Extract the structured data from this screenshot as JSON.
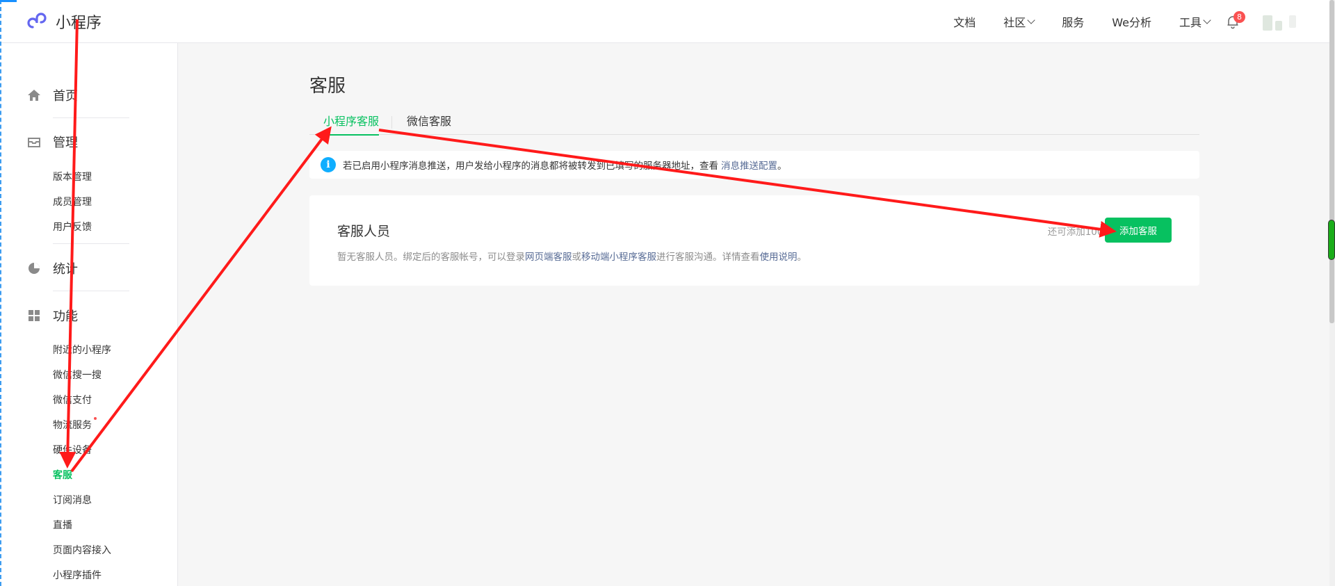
{
  "header": {
    "logo_text": "小程序",
    "nav": [
      {
        "label": "文档",
        "has_dropdown": false
      },
      {
        "label": "社区",
        "has_dropdown": true
      },
      {
        "label": "服务",
        "has_dropdown": false
      },
      {
        "label": "We分析",
        "has_dropdown": false
      },
      {
        "label": "工具",
        "has_dropdown": true
      }
    ],
    "notification_count": "8"
  },
  "sidebar": {
    "home": {
      "label": "首页",
      "icon": "home-icon"
    },
    "manage": {
      "label": "管理",
      "icon": "inbox-icon",
      "items": [
        "版本管理",
        "成员管理",
        "用户反馈"
      ]
    },
    "stats": {
      "label": "统计",
      "icon": "pie-chart-icon"
    },
    "features": {
      "label": "功能",
      "icon": "grid-icon",
      "items": [
        "附近的小程序",
        "微信搜一搜",
        "微信支付",
        "物流服务",
        "硬件设备",
        "客服",
        "订阅消息",
        "直播",
        "页面内容接入",
        "小程序插件"
      ]
    },
    "active_item": "客服"
  },
  "main": {
    "title": "客服",
    "tabs": [
      {
        "label": "小程序客服",
        "active": true
      },
      {
        "label": "微信客服",
        "active": false
      }
    ],
    "notice": {
      "text": "若已启用小程序消息推送，用户发给小程序的消息都将被转发到已填写的服务器地址，查看",
      "link": "消息推送配置",
      "end": "。"
    },
    "card": {
      "title": "客服人员",
      "desc_prefix": "暂无客服人员。绑定后的客服帐号，可以登录",
      "link1": "网页端客服",
      "or": "或",
      "link2": "移动端小程序客服",
      "desc_mid": "进行客服沟通。详情查看",
      "link3": "使用说明",
      "end": "。",
      "quota": "还可添加100个",
      "add_button": "添加客服"
    }
  },
  "colors": {
    "accent": "#07c160",
    "link": "#576b95",
    "badge": "#fa5151",
    "info": "#10aeff",
    "annotation": "#ff1a1a"
  }
}
